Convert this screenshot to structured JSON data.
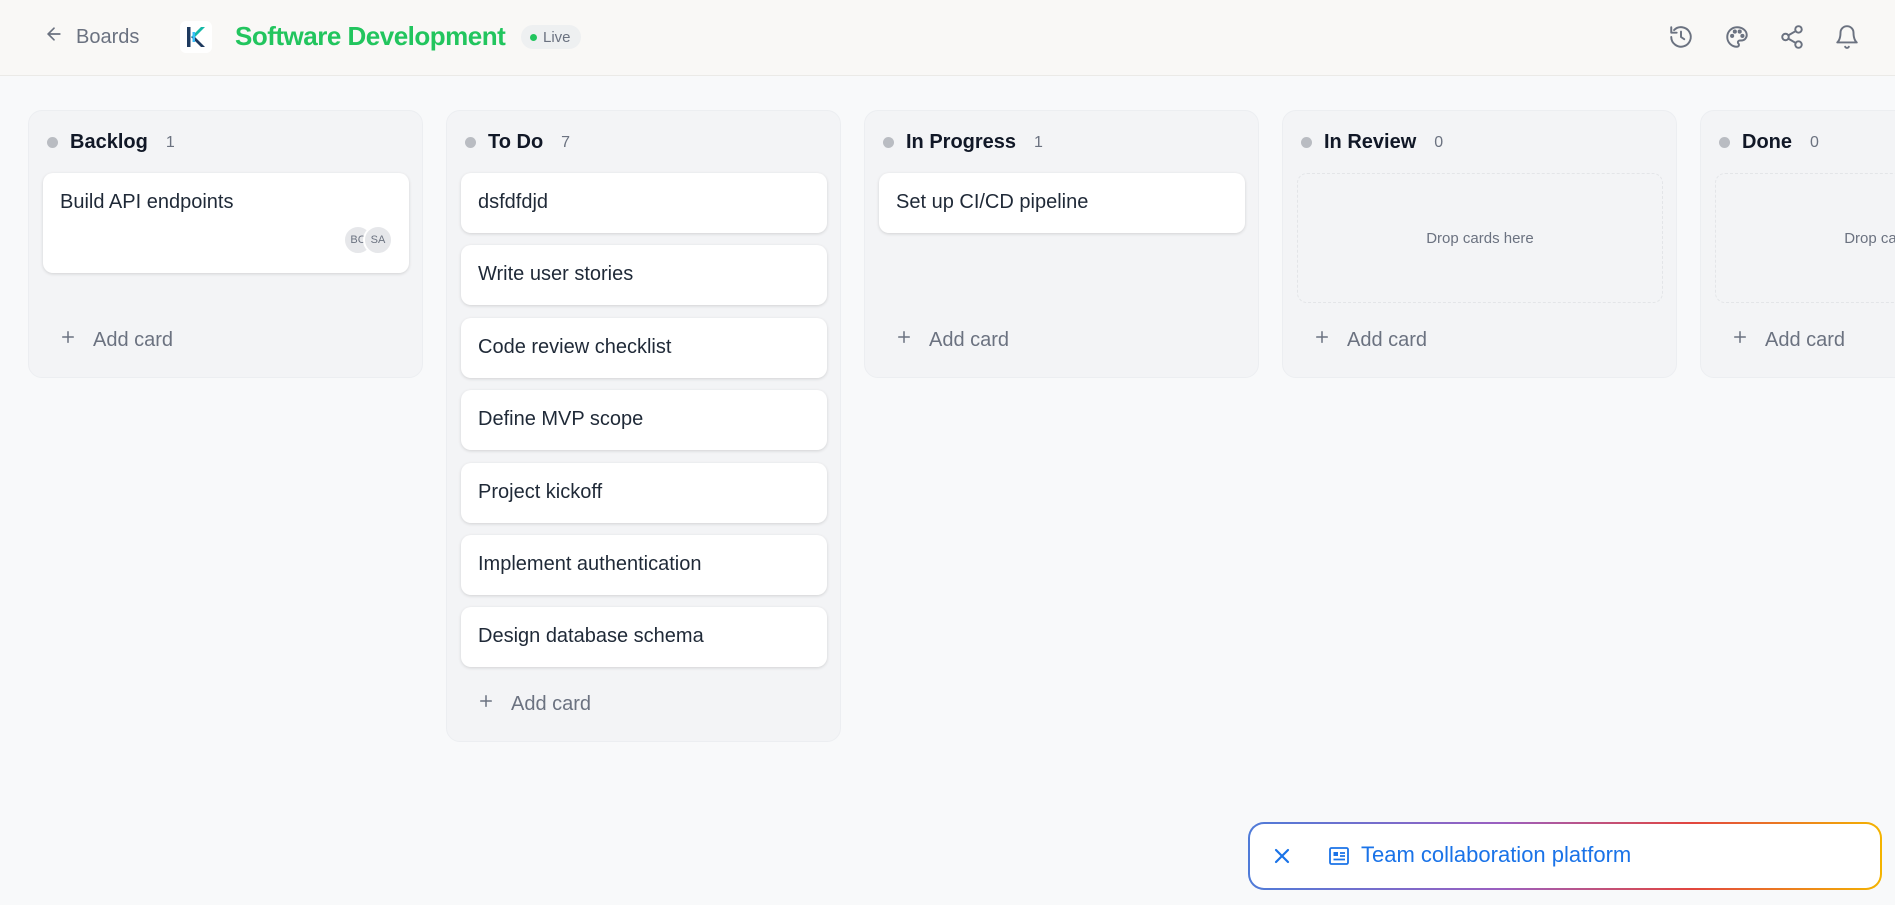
{
  "header": {
    "back_label": "Boards",
    "board_title": "Software Development",
    "status_badge": "Live",
    "icons": [
      "history-icon",
      "palette-icon",
      "share-icon",
      "bell-icon"
    ]
  },
  "columns": [
    {
      "title": "Backlog",
      "count": "1",
      "cards": [
        {
          "title": "Build API endpoints",
          "assignees": [
            "BC",
            "SA"
          ]
        }
      ],
      "add_card_label": "Add card"
    },
    {
      "title": "To Do",
      "count": "7",
      "cards": [
        {
          "title": "dsfdfdjd"
        },
        {
          "title": "Write user stories"
        },
        {
          "title": "Code review checklist"
        },
        {
          "title": "Define MVP scope"
        },
        {
          "title": "Project kickoff"
        },
        {
          "title": "Implement authentication"
        },
        {
          "title": "Design database schema"
        }
      ],
      "add_card_label": "Add card"
    },
    {
      "title": "In Progress",
      "count": "1",
      "cards": [
        {
          "title": "Set up CI/CD pipeline"
        }
      ],
      "add_card_label": "Add card"
    },
    {
      "title": "In Review",
      "count": "0",
      "cards": [],
      "empty_label": "Drop cards here",
      "add_card_label": "Add card"
    },
    {
      "title": "Done",
      "count": "0",
      "cards": [],
      "empty_label": "Drop cards here",
      "add_card_label": "Add card"
    }
  ],
  "toast": {
    "text": "Team collaboration platform",
    "close_icon": "close-icon",
    "icon": "article-icon"
  },
  "colors": {
    "brand_green": "#22c55e",
    "toast_blue": "#1a73e8",
    "column_bg": "#f3f4f6"
  }
}
